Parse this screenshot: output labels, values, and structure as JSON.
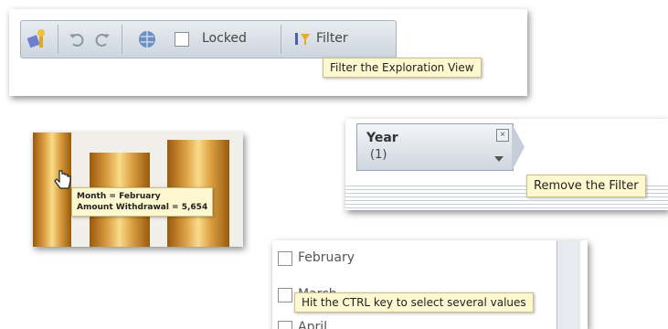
{
  "toolbar": {
    "locked_label": "Locked",
    "filter_label": "Filter",
    "filter_tooltip": "Filter the Exploration View"
  },
  "chart_panel": {
    "tooltip_line1": "Month = February",
    "tooltip_line2": "Amount Withdrawal = 5,654"
  },
  "year_filter": {
    "label": "Year",
    "count": "(1)",
    "remove_tooltip": "Remove the Filter"
  },
  "month_list": {
    "items": [
      "February",
      "March",
      "April"
    ],
    "tooltip": "Hit the CTRL key to select several values"
  },
  "colors": {
    "tooltip_bg": "#fdf8cf",
    "bar_gold": "#dca042",
    "toolbar_bg": "#dfe4ea"
  }
}
